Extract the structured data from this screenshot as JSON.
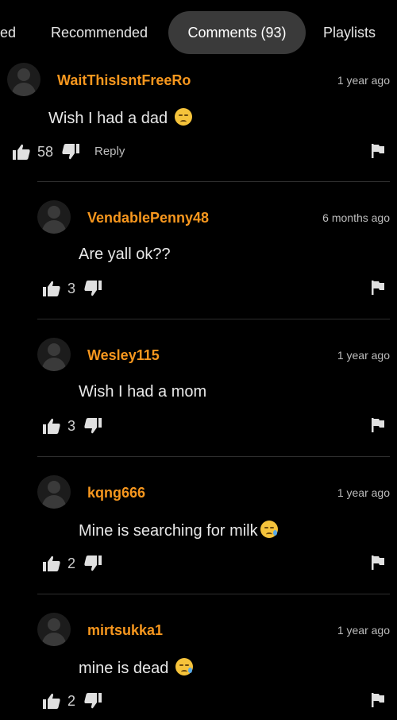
{
  "tabs": {
    "partial": "ed",
    "recommended": "Recommended",
    "comments": "Comments (93)",
    "playlists": "Playlists"
  },
  "comments": [
    {
      "username": "WaitThisIsntFreeRo",
      "time": "1 year ago",
      "text": "Wish I had a dad",
      "emoji": "pensive-face-emoji",
      "likes": "58",
      "reply": "Reply"
    },
    {
      "username": "VendablePenny48",
      "time": "6 months ago",
      "text": "Are yall ok??",
      "likes": "3"
    },
    {
      "username": "Wesley115",
      "time": "1 year ago",
      "text": "Wish I had a mom",
      "likes": "3"
    },
    {
      "username": "kqng666",
      "time": "1 year ago",
      "text": "Mine is searching for milk",
      "emoji": "sad-relieved-face-emoji",
      "likes": "2"
    },
    {
      "username": "mirtsukka1",
      "time": "1 year ago",
      "text": "mine is dead ",
      "emoji": "sad-relieved-face-emoji",
      "likes": "2"
    }
  ],
  "colors": {
    "background": "#000000",
    "username": "#f7971e",
    "active_tab": "#3a3a3a"
  }
}
